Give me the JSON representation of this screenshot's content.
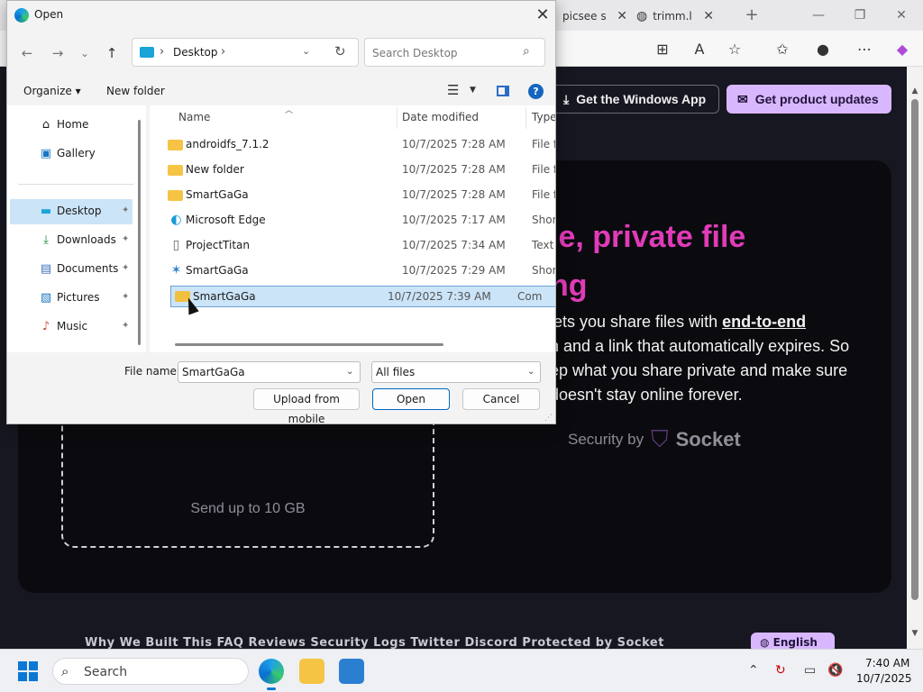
{
  "browser": {
    "tabs": [
      {
        "title": "picsee sh",
        "close": "✕"
      },
      {
        "title": "trimm.lin",
        "close": "✕"
      }
    ],
    "new_tab": "+",
    "window_controls": {
      "minimize": "—",
      "restore": "❐",
      "close": "✕"
    },
    "site": {
      "btn_windows_app": "Get the Windows App",
      "btn_product_updates": "Get product updates",
      "hero_title_line1": "le, private file",
      "hero_title_line2": "ng",
      "hero_desc_pre": "lets you share files with ",
      "hero_desc_e2e": "end-to-end",
      "hero_desc_line2": "n and a link that automatically expires. So",
      "hero_desc_line3": "ep what you share private and make sure",
      "hero_desc_line4": "doesn't stay online forever.",
      "security_by": "Security by",
      "socket": "Socket",
      "drop_text": "Send up to 10 GB",
      "footer_links": "Why We Built This   FAQ   Reviews   Security   Logs   Twitter   Discord   Protected by Socket",
      "language": "English"
    }
  },
  "dialog": {
    "title": "Open",
    "close": "✕",
    "nav": {
      "back": "←",
      "forward": "→",
      "recent": "⌄",
      "up": "↑"
    },
    "address": {
      "location": "Desktop",
      "sep": "›"
    },
    "search_placeholder": "Search Desktop",
    "commands": {
      "organize": "Organize ▾",
      "new_folder": "New folder",
      "help": "?"
    },
    "nav_pane": [
      {
        "label": "Home",
        "icon": "⌂",
        "pinned": false
      },
      {
        "label": "Gallery",
        "icon": "▣",
        "pinned": false
      },
      {
        "label": "Desktop",
        "icon": "▬",
        "pinned": true,
        "selected": true
      },
      {
        "label": "Downloads",
        "icon": "⤓",
        "pinned": true
      },
      {
        "label": "Documents",
        "icon": "▤",
        "pinned": true
      },
      {
        "label": "Pictures",
        "icon": "▧",
        "pinned": true
      },
      {
        "label": "Music",
        "icon": "♪",
        "pinned": true
      }
    ],
    "pin_icon": "📌",
    "columns": {
      "name": "Name",
      "date": "Date modified",
      "type": "Type"
    },
    "files": [
      {
        "name": "androidfs_7.1.2",
        "date": "10/7/2025 7:28 AM",
        "type": "File fo",
        "kind": "folder"
      },
      {
        "name": "New folder",
        "date": "10/7/2025 7:28 AM",
        "type": "File fo",
        "kind": "folder"
      },
      {
        "name": "SmartGaGa",
        "date": "10/7/2025 7:28 AM",
        "type": "File fo",
        "kind": "folder"
      },
      {
        "name": "Microsoft Edge",
        "date": "10/7/2025 7:17 AM",
        "type": "Short",
        "kind": "edge"
      },
      {
        "name": "ProjectTitan",
        "date": "10/7/2025 7:34 AM",
        "type": "Text D",
        "kind": "text"
      },
      {
        "name": "SmartGaGa",
        "date": "10/7/2025 7:29 AM",
        "type": "Short",
        "kind": "shortcut"
      },
      {
        "name": "SmartGaGa",
        "date": "10/7/2025 7:39 AM",
        "type": "Com",
        "kind": "zip",
        "selected": true
      }
    ],
    "file_name_label": "File name:",
    "file_name_value": "SmartGaGa",
    "file_type": "All files",
    "buttons": {
      "upload": "Upload from mobile",
      "open": "Open",
      "cancel": "Cancel"
    }
  },
  "taskbar": {
    "search": "Search",
    "time": "7:40 AM",
    "date": "10/7/2025"
  },
  "colors": {
    "accent": "#0067c0",
    "selection": "#cce4f7",
    "hero_pink": "#e13bb8",
    "lavender": "#d9b7ff"
  }
}
